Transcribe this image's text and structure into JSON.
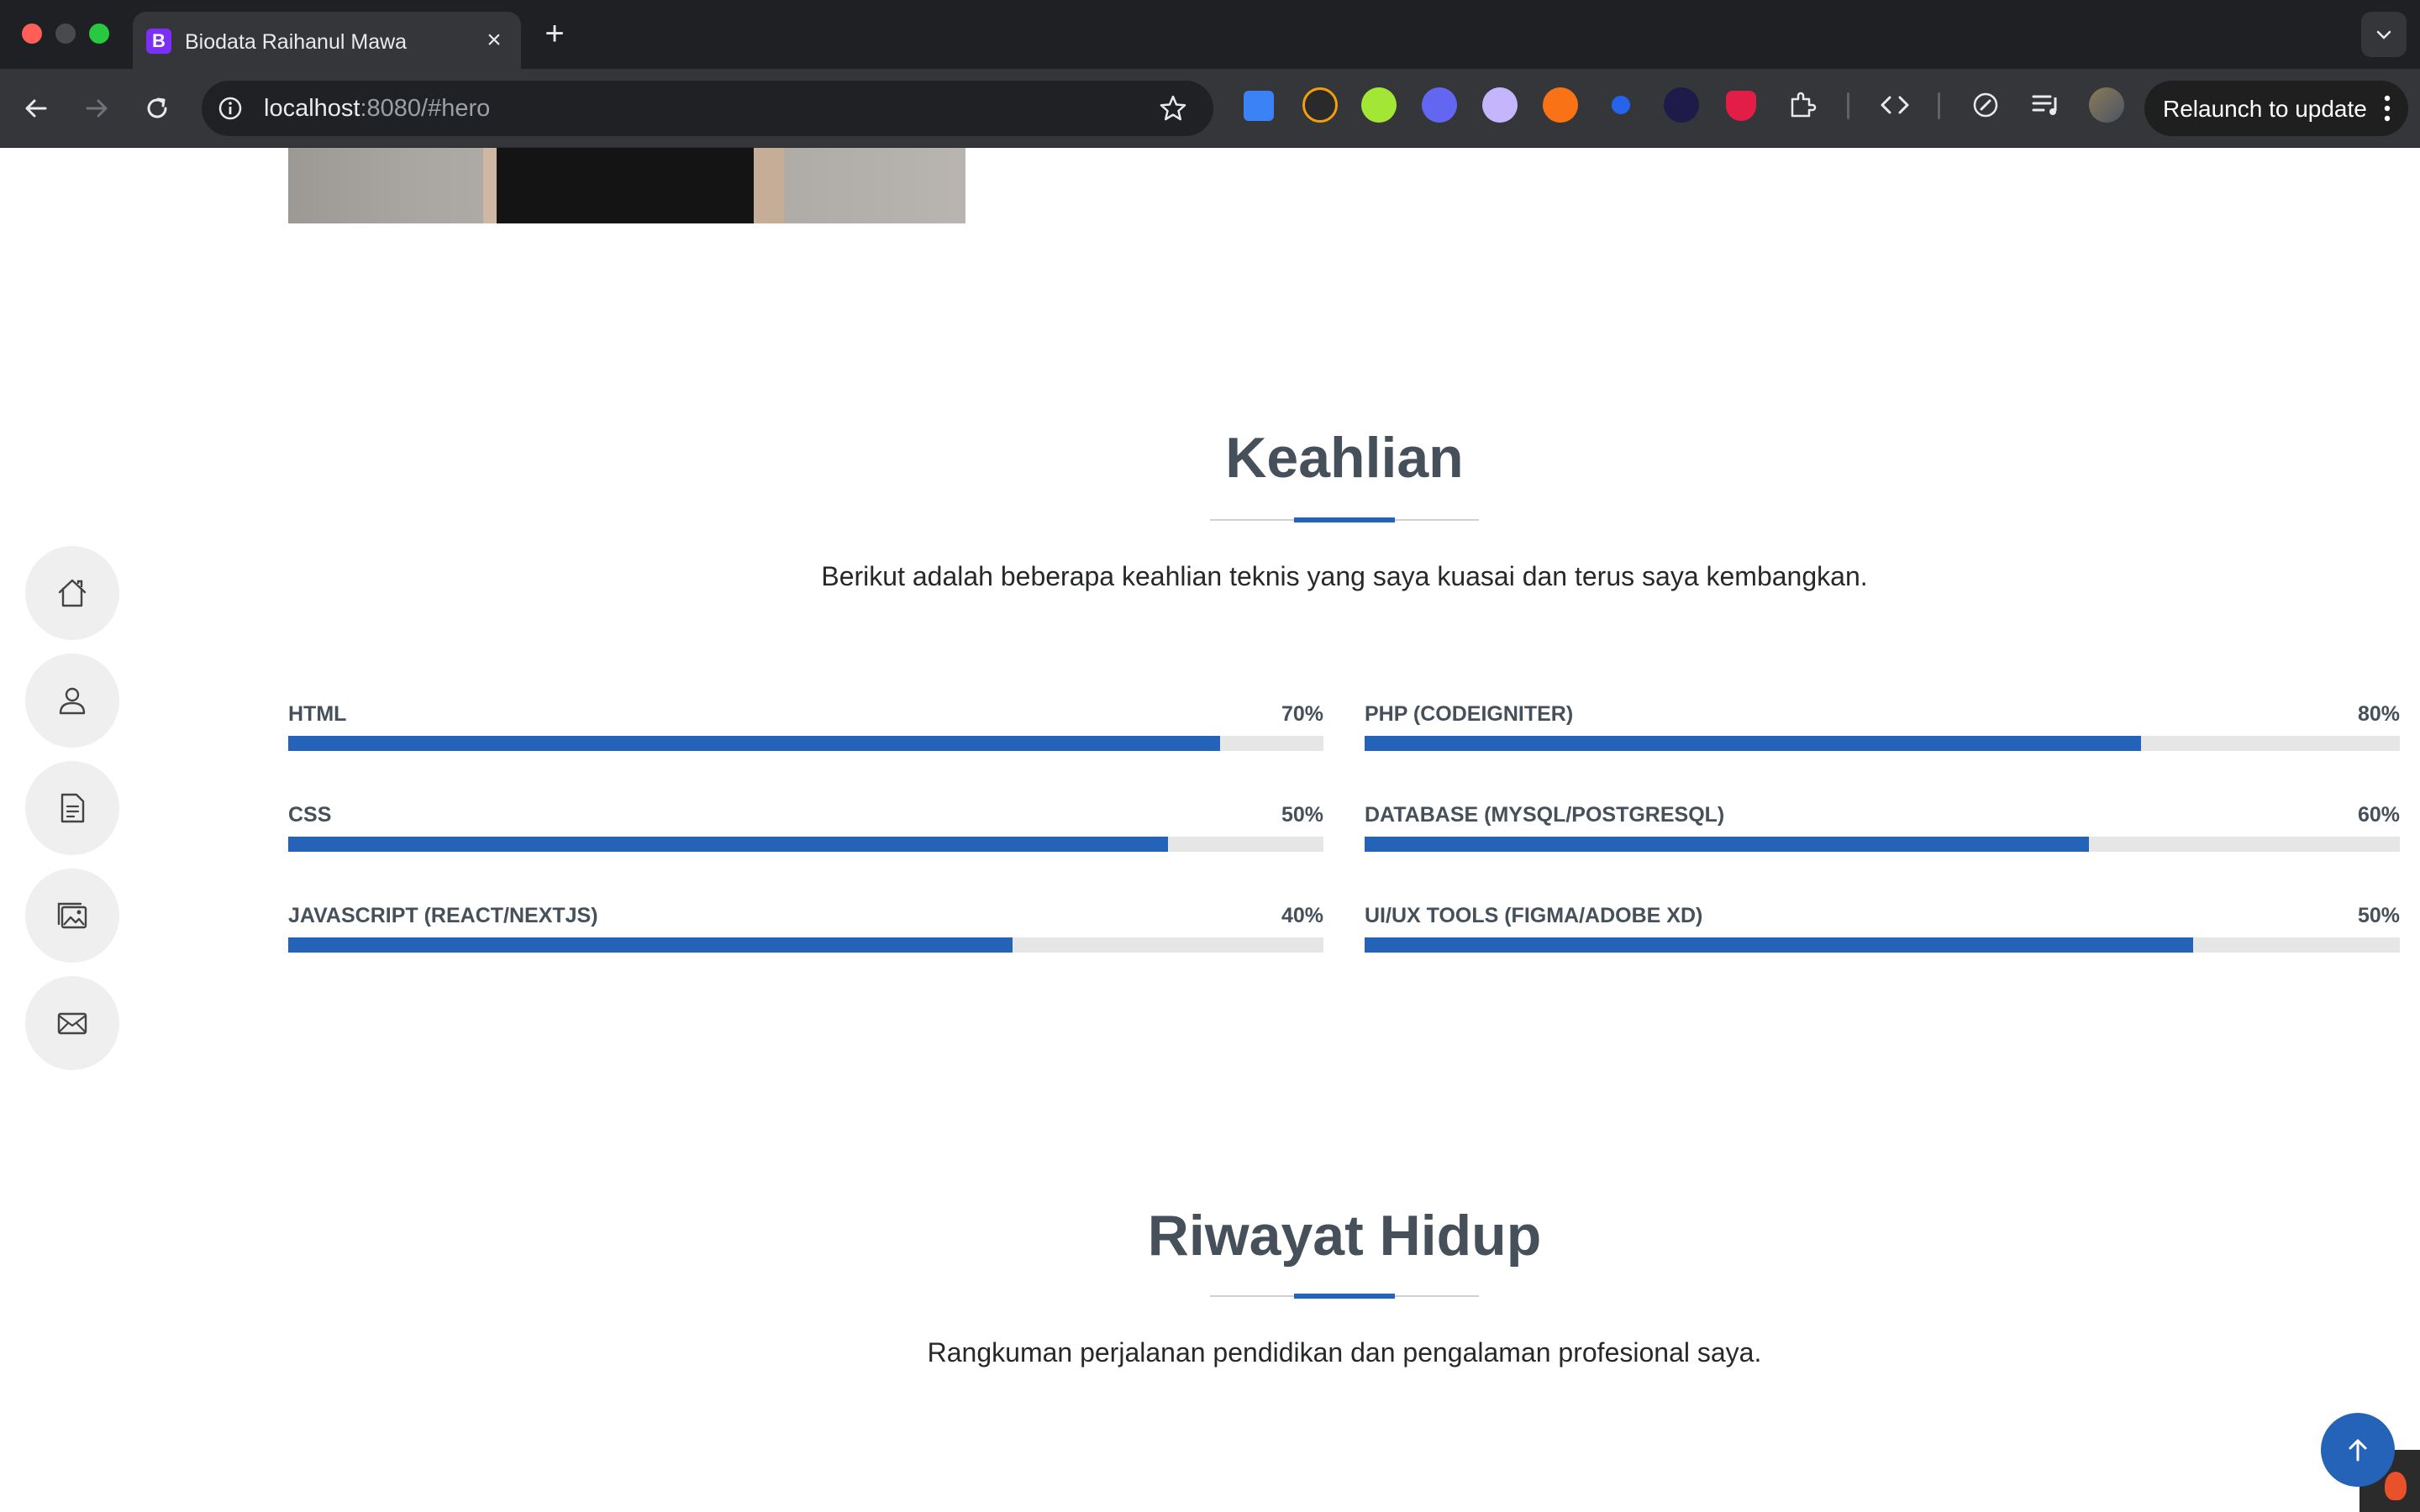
{
  "browser": {
    "tab_title": "Biodata Raihanul Mawa",
    "tab_favicon_letter": "B",
    "url_host": "localhost",
    "url_rest": ":8080/#hero",
    "relaunch_label": "Relaunch to update"
  },
  "sidebar": {
    "items": [
      {
        "icon": "home-icon"
      },
      {
        "icon": "person-icon"
      },
      {
        "icon": "document-icon"
      },
      {
        "icon": "images-icon"
      },
      {
        "icon": "envelope-icon"
      }
    ]
  },
  "skills_section": {
    "title": "Keahlian",
    "description": "Berikut adalah beberapa keahlian teknis yang saya kuasai dan terus saya kembangkan.",
    "skills": [
      {
        "name": "HTML",
        "value_label": "70%",
        "fill": 0.9
      },
      {
        "name": "PHP (CODEIGNITER)",
        "value_label": "80%",
        "fill": 0.75
      },
      {
        "name": "CSS",
        "value_label": "50%",
        "fill": 0.85
      },
      {
        "name": "DATABASE (MYSQL/POSTGRESQL)",
        "value_label": "60%",
        "fill": 0.7
      },
      {
        "name": "JAVASCRIPT (REACT/NEXTJS)",
        "value_label": "40%",
        "fill": 0.7
      },
      {
        "name": "UI/UX TOOLS (FIGMA/ADOBE XD)",
        "value_label": "50%",
        "fill": 0.8
      }
    ]
  },
  "resume_section": {
    "title": "Riwayat Hidup",
    "description": "Rangkuman perjalanan pendidikan dan pengalaman profesional saya."
  },
  "colors": {
    "accent": "#2563b8",
    "heading": "#45505b",
    "track": "#e6e6e6"
  }
}
